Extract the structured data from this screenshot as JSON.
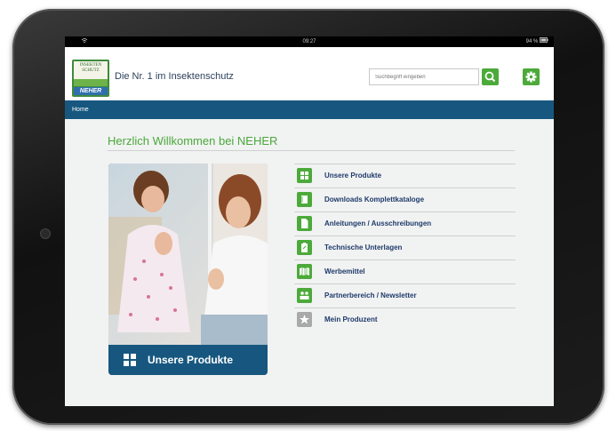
{
  "statusbar": {
    "time": "09:27",
    "battery": "94 %"
  },
  "header": {
    "logo": {
      "top_text": "INSEKTEN SCHUTZ",
      "brand": "NEHER"
    },
    "tagline": "Die Nr. 1 im Insektenschutz",
    "search_placeholder": "Suchbegriff eingeben"
  },
  "nav": {
    "home": "Home"
  },
  "main": {
    "welcome": "Herzlich Willkommen bei NEHER",
    "hero_label": "Unsere Produkte",
    "menu": [
      {
        "label": "Unsere Produkte",
        "icon": "grid-icon"
      },
      {
        "label": "Downloads Komplettkataloge",
        "icon": "catalog-icon"
      },
      {
        "label": "Anleitungen / Ausschreibungen",
        "icon": "document-icon"
      },
      {
        "label": "Technische Unterlagen",
        "icon": "clipboard-icon"
      },
      {
        "label": "Werbemittel",
        "icon": "map-icon"
      },
      {
        "label": "Partnerbereich / Newsletter",
        "icon": "people-icon"
      },
      {
        "label": "Mein Produzent",
        "icon": "star-icon"
      }
    ]
  },
  "colors": {
    "brand_green": "#4caa3a",
    "nav_blue": "#17577f",
    "link_text": "#1e3a6a"
  }
}
